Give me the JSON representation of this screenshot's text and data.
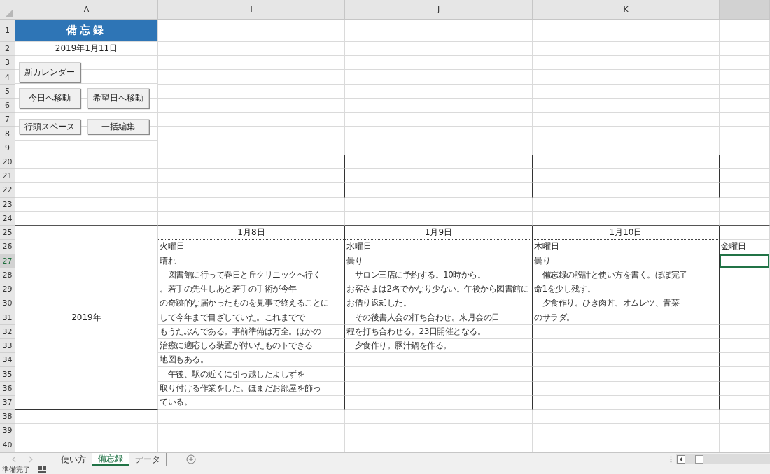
{
  "column_headers": [
    {
      "label": "A",
      "selected": false
    },
    {
      "label": "I",
      "selected": false
    },
    {
      "label": "J",
      "selected": false
    },
    {
      "label": "K",
      "selected": false
    },
    {
      "selected": true
    }
  ],
  "rows": [
    {
      "label": "1",
      "selected": false
    },
    {
      "label": "2",
      "selected": false
    },
    {
      "label": "3",
      "selected": false
    },
    {
      "label": "4",
      "selected": false
    },
    {
      "label": "5",
      "selected": false
    },
    {
      "label": "6",
      "selected": false
    },
    {
      "label": "7",
      "selected": false
    },
    {
      "label": "8",
      "selected": false
    },
    {
      "label": "9",
      "selected": false
    },
    {
      "label": "20",
      "selected": false
    },
    {
      "label": "21",
      "selected": false
    },
    {
      "label": "22",
      "selected": false
    },
    {
      "label": "23",
      "selected": false
    },
    {
      "label": "24",
      "selected": false
    },
    {
      "label": "25",
      "selected": false
    },
    {
      "label": "26",
      "selected": false
    },
    {
      "label": "27",
      "selected": true
    },
    {
      "label": "28",
      "selected": false
    },
    {
      "label": "29",
      "selected": false
    },
    {
      "label": "30",
      "selected": false
    },
    {
      "label": "31",
      "selected": false
    },
    {
      "label": "32",
      "selected": false
    },
    {
      "label": "33",
      "selected": false
    },
    {
      "label": "34",
      "selected": false
    },
    {
      "label": "35",
      "selected": false
    },
    {
      "label": "36",
      "selected": false
    },
    {
      "label": "37",
      "selected": false
    },
    {
      "label": "38",
      "selected": false
    },
    {
      "label": "39",
      "selected": false
    },
    {
      "label": "40",
      "selected": false
    }
  ],
  "title": "備忘録",
  "date": "2019年1月11日",
  "buttons": [
    "新カレンダー",
    "今日へ移動",
    "希望日へ移動",
    "行頭スペース",
    "一括編集"
  ],
  "year_label": "2019年",
  "days": [
    {
      "date": "1月8日",
      "weekday": "火曜日",
      "lines": [
        "晴れ",
        "　図書館に行って春日と丘クリニックへ行く",
        "。若手の先生しあと若手の手術が今年",
        "の奇跡的な届かったものを見事で終えることに",
        "して今年まで目ざしていた。これまでで",
        "もうたぶんである。事前準備は万全。ほかの",
        "治療に適応しる装置が付いたものトできる",
        "地図もある。",
        "　午後、駅の近くに引っ越したよしずを",
        "取り付ける作業をした。ほまだお部屋を飾っ",
        "ている。"
      ]
    },
    {
      "date": "1月9日",
      "weekday": "水曜日",
      "lines": [
        "曇り",
        "　サロン三店に予約する。10時から。",
        "お客さまは2名でかなり少ない。午後から図書館に",
        "お借り返却した。",
        "　その後書人会の打ち合わせ。来月会の日",
        "程を打ち合わせる。23日開催となる。",
        "　夕食作り。豚汁鍋を作る。"
      ]
    },
    {
      "date": "1月10日",
      "weekday": "木曜日",
      "lines": [
        "曇り",
        "　備忘録の設計と使い方を書く。ほぼ完了",
        "命1を少し残す。",
        "　夕食作り。ひき肉丼、オムレツ、青菜",
        "のサラダ。"
      ]
    }
  ],
  "extra_day": {
    "weekday": "金曜日"
  },
  "sheet_tabs": [
    {
      "label": "使い方",
      "selected": false
    },
    {
      "label": "備忘録",
      "selected": true
    },
    {
      "label": "データ",
      "selected": false
    }
  ],
  "status": "準備完了"
}
